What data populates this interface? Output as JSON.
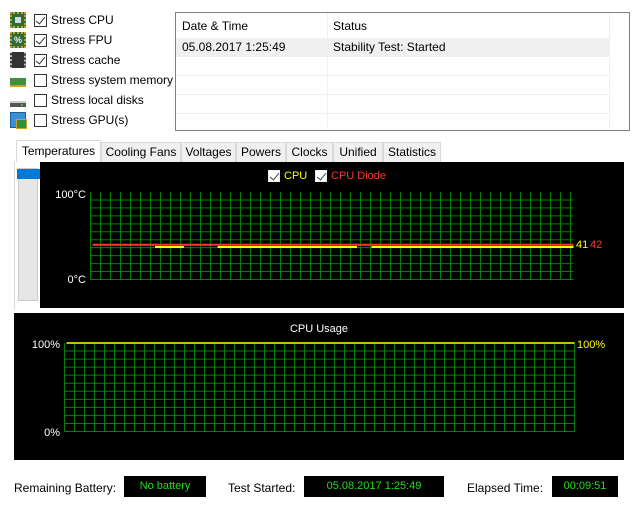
{
  "stress_options": [
    {
      "label": "Stress CPU",
      "checked": true,
      "icon": "cpu-chip-icon"
    },
    {
      "label": "Stress FPU",
      "checked": true,
      "icon": "fpu-icon"
    },
    {
      "label": "Stress cache",
      "checked": true,
      "icon": "cache-chip-icon"
    },
    {
      "label": "Stress system memory",
      "checked": false,
      "icon": "memory-module-icon"
    },
    {
      "label": "Stress local disks",
      "checked": false,
      "icon": "hard-disk-icon"
    },
    {
      "label": "Stress GPU(s)",
      "checked": false,
      "icon": "gpu-monitor-icon"
    }
  ],
  "log": {
    "columns": [
      "Date & Time",
      "Status"
    ],
    "rows": [
      [
        "05.08.2017 1:25:49",
        "Stability Test: Started"
      ]
    ]
  },
  "tabs": [
    "Temperatures",
    "Cooling Fans",
    "Voltages",
    "Powers",
    "Clocks",
    "Unified",
    "Statistics"
  ],
  "active_tab": "Temperatures",
  "chart_data": [
    {
      "type": "line",
      "title": "",
      "legend": [
        {
          "name": "CPU",
          "checked": true,
          "color": "#ffff00"
        },
        {
          "name": "CPU Diode",
          "checked": true,
          "color": "#ff3333"
        }
      ],
      "ylabel_top": "100°C",
      "ylabel_bottom": "0°C",
      "ylim": [
        0,
        100
      ],
      "grid": true,
      "grid_color": "#008000",
      "series": [
        {
          "name": "CPU",
          "color": "#ffff00",
          "current": "41",
          "segments": [
            [
              0.13,
              0.19,
              41
            ],
            [
              0.26,
              0.55,
              41
            ],
            [
              0.58,
              1.0,
              41
            ]
          ]
        },
        {
          "name": "CPU Diode",
          "color": "#ff3333",
          "current": "42",
          "segments": [
            [
              0.0,
              1.0,
              42
            ]
          ]
        }
      ]
    },
    {
      "type": "line",
      "title": "CPU Usage",
      "ylabel_top": "100%",
      "ylabel_bottom": "0%",
      "ylim": [
        0,
        100
      ],
      "grid": true,
      "grid_color": "#008000",
      "series": [
        {
          "name": "CPU Usage",
          "color": "#ffff00",
          "current": "100%",
          "value": 100
        }
      ]
    }
  ],
  "footer": {
    "battery_label": "Remaining Battery:",
    "battery_value": "No battery",
    "started_label": "Test Started:",
    "started_value": "05.08.2017 1:25:49",
    "elapsed_label": "Elapsed Time:",
    "elapsed_value": "00:09:51"
  }
}
